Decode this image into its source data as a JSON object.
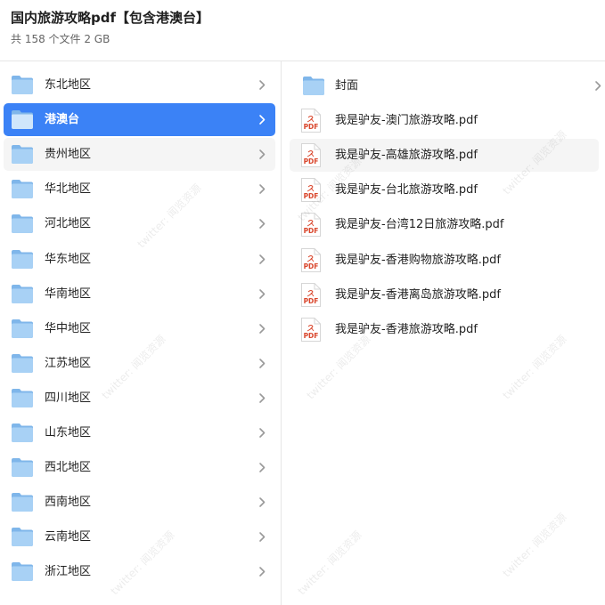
{
  "header": {
    "title": "国内旅游攻略pdf【包含港澳台】",
    "subtitle": "共 158 个文件 2 GB"
  },
  "left_pane": {
    "selected_index": 1,
    "hover_index": 2,
    "folders": [
      {
        "label": "东北地区"
      },
      {
        "label": "港澳台"
      },
      {
        "label": "贵州地区"
      },
      {
        "label": "华北地区"
      },
      {
        "label": "河北地区"
      },
      {
        "label": "华东地区"
      },
      {
        "label": "华南地区"
      },
      {
        "label": "华中地区"
      },
      {
        "label": "江苏地区"
      },
      {
        "label": "四川地区"
      },
      {
        "label": "山东地区"
      },
      {
        "label": "西北地区"
      },
      {
        "label": "西南地区"
      },
      {
        "label": "云南地区"
      },
      {
        "label": "浙江地区"
      }
    ]
  },
  "right_pane": {
    "hover_index": 2,
    "items": [
      {
        "label": "封面",
        "kind": "folder"
      },
      {
        "label": "我是驴友-澳门旅游攻略.pdf",
        "kind": "pdf"
      },
      {
        "label": "我是驴友-高雄旅游攻略.pdf",
        "kind": "pdf"
      },
      {
        "label": "我是驴友-台北旅游攻略.pdf",
        "kind": "pdf"
      },
      {
        "label": "我是驴友-台湾12日旅游攻略.pdf",
        "kind": "pdf"
      },
      {
        "label": "我是驴友-香港购物旅游攻略.pdf",
        "kind": "pdf"
      },
      {
        "label": "我是驴友-香港离岛旅游攻略.pdf",
        "kind": "pdf"
      },
      {
        "label": "我是驴友-香港旅游攻略.pdf",
        "kind": "pdf"
      }
    ]
  },
  "icons": {
    "folder": "folder-icon",
    "pdf": "pdf-file-icon",
    "chevron": "chevron-right-icon",
    "pdf_badge_text": "PDF"
  },
  "colors": {
    "selection": "#3b82f6",
    "folder_light": "#a8d1f5",
    "folder_dark": "#7fb6ea",
    "pdf_red": "#d9452b",
    "chevron": "#9a9a9a"
  },
  "watermark": {
    "text": "twitter: 闻览资源"
  }
}
